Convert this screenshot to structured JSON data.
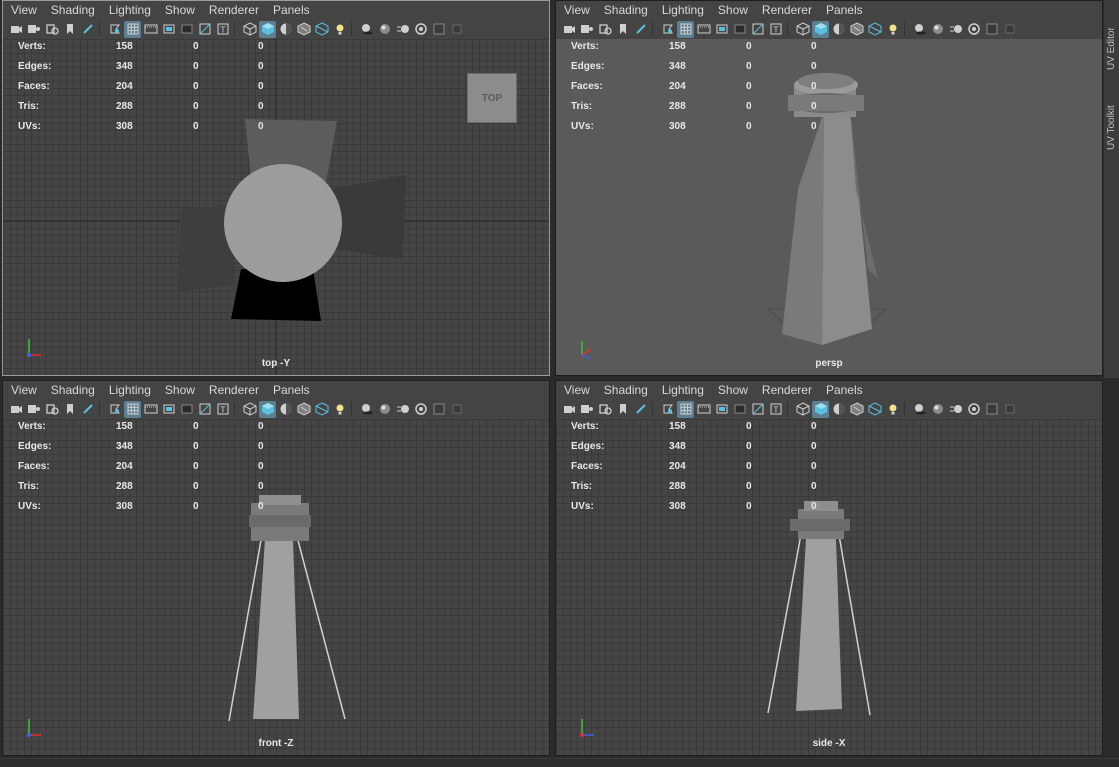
{
  "menu": [
    "View",
    "Shading",
    "Lighting",
    "Show",
    "Renderer",
    "Panels"
  ],
  "toolbar_icons": [
    "camera-icon",
    "camera-attr-icon",
    "bookmark-icon",
    "bookmark2-icon",
    "pencil-icon",
    "sep",
    "gate-icon",
    "grid-icon",
    "film-gate-icon",
    "resolution-gate-icon",
    "gate-mask-icon",
    "field-chart-icon",
    "safe-title-icon",
    "sep",
    "wireframe-icon",
    "smooth-shade-icon",
    "shade-all-icon",
    "wireframe-on-shaded-icon",
    "xray-icon",
    "lights-icon",
    "sep",
    "shadows-icon",
    "ambient-occlusion-icon",
    "motion-blur-icon",
    "anti-alias-icon",
    "depth-of-field-icon",
    "isolate-icon"
  ],
  "hud": {
    "rows": [
      {
        "label": "Verts:",
        "v1": "158",
        "v2": "0",
        "v3": "0"
      },
      {
        "label": "Edges:",
        "v1": "348",
        "v2": "0",
        "v3": "0"
      },
      {
        "label": "Faces:",
        "v1": "204",
        "v2": "0",
        "v3": "0"
      },
      {
        "label": "Tris:",
        "v1": "288",
        "v2": "0",
        "v3": "0"
      },
      {
        "label": "UVs:",
        "v1": "308",
        "v2": "0",
        "v3": "0"
      }
    ]
  },
  "viewports": [
    {
      "id": "top",
      "camera": "top -Y",
      "viewcube": "TOP"
    },
    {
      "id": "persp",
      "camera": "persp"
    },
    {
      "id": "front",
      "camera": "front -Z"
    },
    {
      "id": "side",
      "camera": "side -X"
    }
  ],
  "side_tabs": [
    "UV Editor",
    "UV Toolkit"
  ],
  "colors": {
    "active_toggle": "#5d7f92",
    "accent_cyan": "#5bc0de",
    "axis_x": "#e03030",
    "axis_y": "#40c040",
    "axis_z": "#4060e0"
  }
}
